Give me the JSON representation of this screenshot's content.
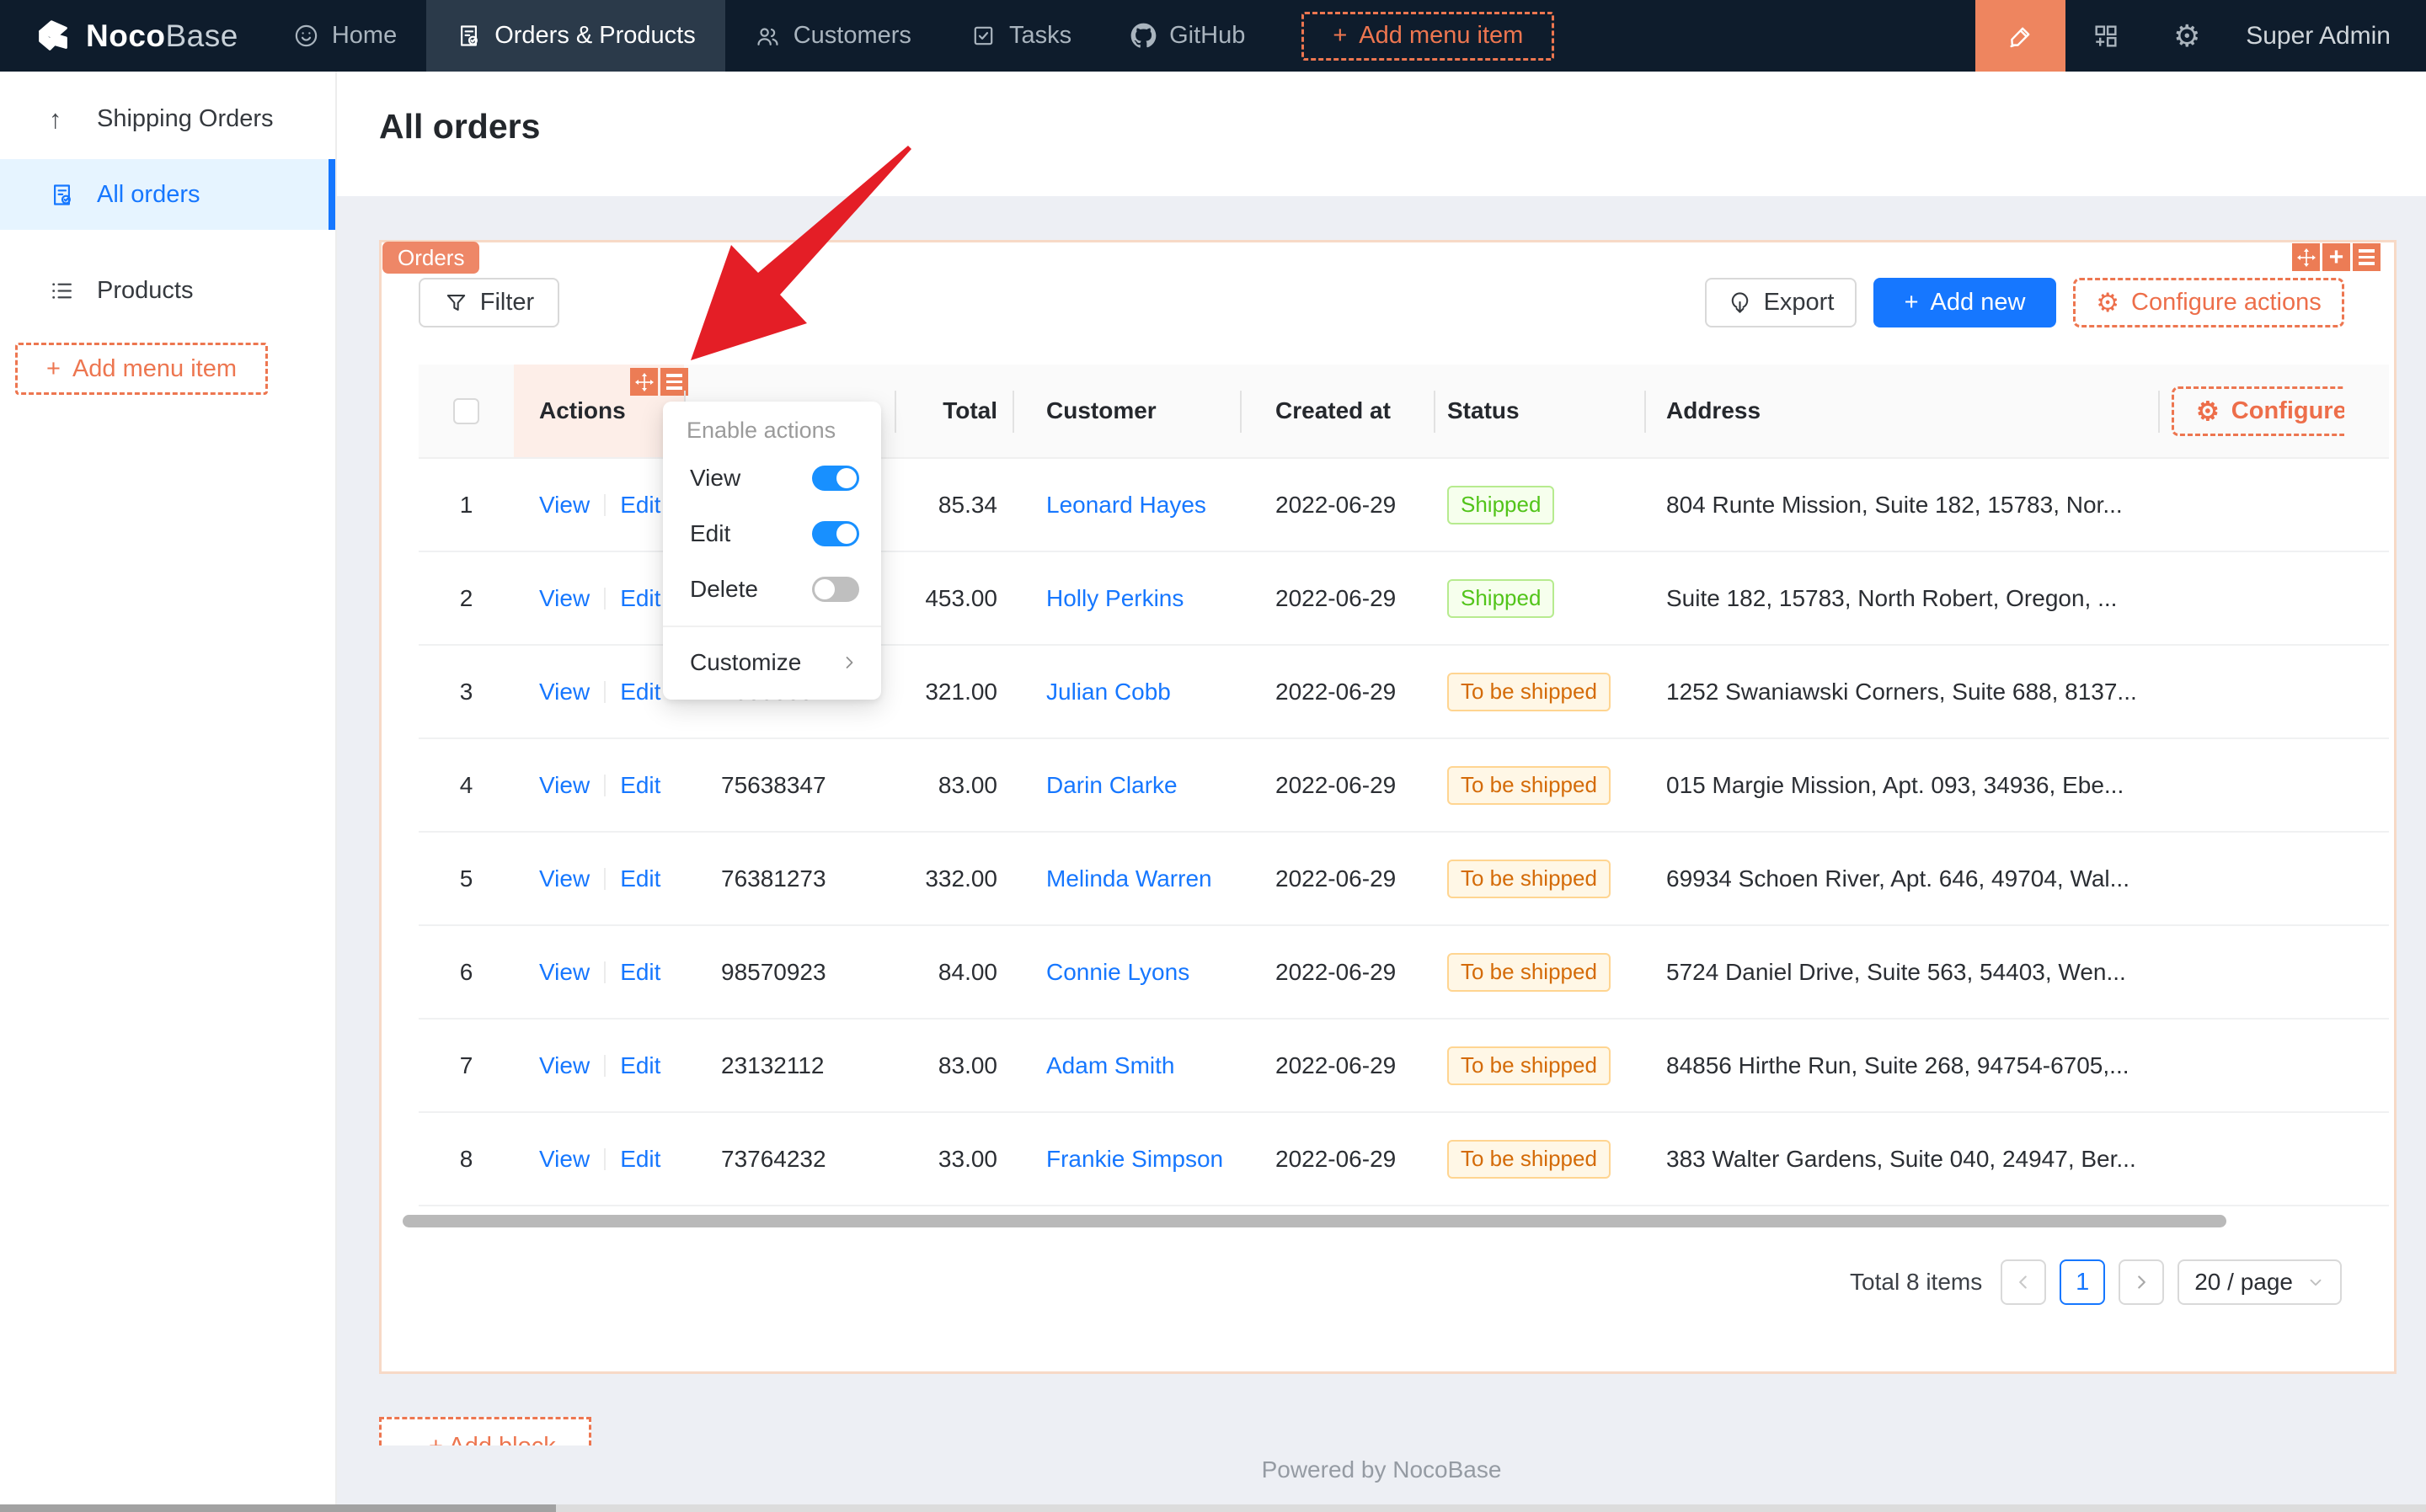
{
  "navbar": {
    "logo": {
      "bold": "Noco",
      "light": "Base"
    },
    "items": [
      {
        "label": "Home",
        "icon": "home-icon",
        "active": false
      },
      {
        "label": "Orders & Products",
        "icon": "orders-icon",
        "active": true
      },
      {
        "label": "Customers",
        "icon": "customers-icon",
        "active": false
      },
      {
        "label": "Tasks",
        "icon": "tasks-icon",
        "active": false
      },
      {
        "label": "GitHub",
        "icon": "github-icon",
        "active": false
      }
    ],
    "add_menu_item": "Add menu item",
    "user": "Super Admin"
  },
  "sidebar": {
    "items": [
      {
        "label": "Shipping Orders",
        "icon": "arrow-up-icon",
        "active": false
      },
      {
        "label": "All orders",
        "icon": "file-check-icon",
        "active": true
      },
      {
        "label": "Products",
        "icon": "list-icon",
        "active": false
      }
    ],
    "add_menu_item": "Add menu item"
  },
  "page": {
    "title": "All orders",
    "block_tag": "Orders",
    "add_block": "+ Add block",
    "powered_by": "Powered by NocoBase"
  },
  "toolbar": {
    "filter": "Filter",
    "export": "Export",
    "add_new": "Add new",
    "configure_actions": "Configure actions"
  },
  "dropdown": {
    "title": "Enable actions",
    "items": [
      {
        "label": "View",
        "enabled": true
      },
      {
        "label": "Edit",
        "enabled": true
      },
      {
        "label": "Delete",
        "enabled": false
      }
    ],
    "customize": "Customize"
  },
  "table": {
    "headers": {
      "actions": "Actions",
      "total": "Total",
      "customer": "Customer",
      "created_at": "Created at",
      "status": "Status",
      "address": "Address",
      "configure_columns": "Configure columns"
    },
    "row_actions": {
      "view": "View",
      "edit": "Edit"
    },
    "rows": [
      {
        "num": "1",
        "order_no": "",
        "total": "85.34",
        "customer": "Leonard Hayes",
        "created_at": "2022-06-29",
        "status": "Shipped",
        "status_color": "green",
        "address": "804 Runte Mission, Suite 182, 15783, Nor..."
      },
      {
        "num": "2",
        "order_no": "",
        "total": "453.00",
        "customer": "Holly Perkins",
        "created_at": "2022-06-29",
        "status": "Shipped",
        "status_color": "green",
        "address": "Suite 182, 15783, North Robert, Oregon, ..."
      },
      {
        "num": "3",
        "order_no": "43895854",
        "total": "321.00",
        "customer": "Julian Cobb",
        "created_at": "2022-06-29",
        "status": "To be shipped",
        "status_color": "orange",
        "address": "1252 Swaniawski Corners, Suite 688, 8137..."
      },
      {
        "num": "4",
        "order_no": "75638347",
        "total": "83.00",
        "customer": "Darin Clarke",
        "created_at": "2022-06-29",
        "status": "To be shipped",
        "status_color": "orange",
        "address": "015 Margie Mission, Apt. 093, 34936, Ebe..."
      },
      {
        "num": "5",
        "order_no": "76381273",
        "total": "332.00",
        "customer": "Melinda Warren",
        "created_at": "2022-06-29",
        "status": "To be shipped",
        "status_color": "orange",
        "address": "69934 Schoen River, Apt. 646, 49704, Wal..."
      },
      {
        "num": "6",
        "order_no": "98570923",
        "total": "84.00",
        "customer": "Connie Lyons",
        "created_at": "2022-06-29",
        "status": "To be shipped",
        "status_color": "orange",
        "address": "5724 Daniel Drive, Suite 563, 54403, Wen..."
      },
      {
        "num": "7",
        "order_no": "23132112",
        "total": "83.00",
        "customer": "Adam Smith",
        "created_at": "2022-06-29",
        "status": "To be shipped",
        "status_color": "orange",
        "address": "84856 Hirthe Run, Suite 268, 94754-6705,..."
      },
      {
        "num": "8",
        "order_no": "73764232",
        "total": "33.00",
        "customer": "Frankie Simpson",
        "created_at": "2022-06-29",
        "status": "To be shipped",
        "status_color": "orange",
        "address": "383 Walter Gardens, Suite 040, 24947, Ber..."
      }
    ]
  },
  "pagination": {
    "total": "Total 8 items",
    "current_page": "1",
    "page_size": "20 / page"
  },
  "icons": {
    "plus": "+",
    "up_arrow": "↑",
    "gear": "⚙"
  },
  "colors": {
    "navbar_bg": "#0e1c2c",
    "accent_orange": "#ed7650",
    "solid_orange": "#ec7c55",
    "primary_blue": "#1677ff",
    "switch_on_blue": "#1890ff",
    "badge_green_text": "#52c41a",
    "badge_orange_text": "#d46b08",
    "arrow_red": "#e41e26"
  }
}
